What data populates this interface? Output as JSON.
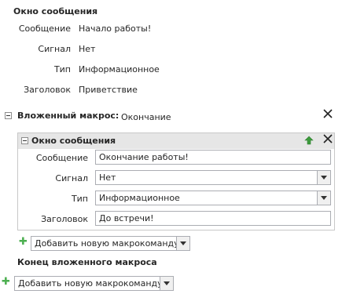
{
  "msg1": {
    "title": "Окно сообщения",
    "rows": [
      {
        "label": "Сообщение",
        "value": "Начало работы!"
      },
      {
        "label": "Сигнал",
        "value": "Нет"
      },
      {
        "label": "Тип",
        "value": "Информационное"
      },
      {
        "label": "Заголовок",
        "value": "Приветствие"
      }
    ]
  },
  "submacro": {
    "label": "Вложенный макрос:",
    "name": "Окончание",
    "end_label": "Конец вложенного макроса"
  },
  "msg2": {
    "title": "Окно сообщения",
    "rows": [
      {
        "label": "Сообщение",
        "value": "Окончание работы!"
      },
      {
        "label": "Сигнал",
        "value": "Нет"
      },
      {
        "label": "Тип",
        "value": "Информационное"
      },
      {
        "label": "Заголовок",
        "value": "До встречи!"
      }
    ]
  },
  "add_action": {
    "inner": "Добавить новую макрокоманду",
    "outer": "Добавить новую макрокоманду"
  },
  "icons": {
    "plus_color": "#4caf50",
    "arrow_up_color": "#3c9b3c",
    "close": "close-icon",
    "move_up": "arrow-up-icon",
    "collapse": "collapse-icon",
    "add": "plus-icon",
    "dropdown": "chevron-down-icon"
  }
}
